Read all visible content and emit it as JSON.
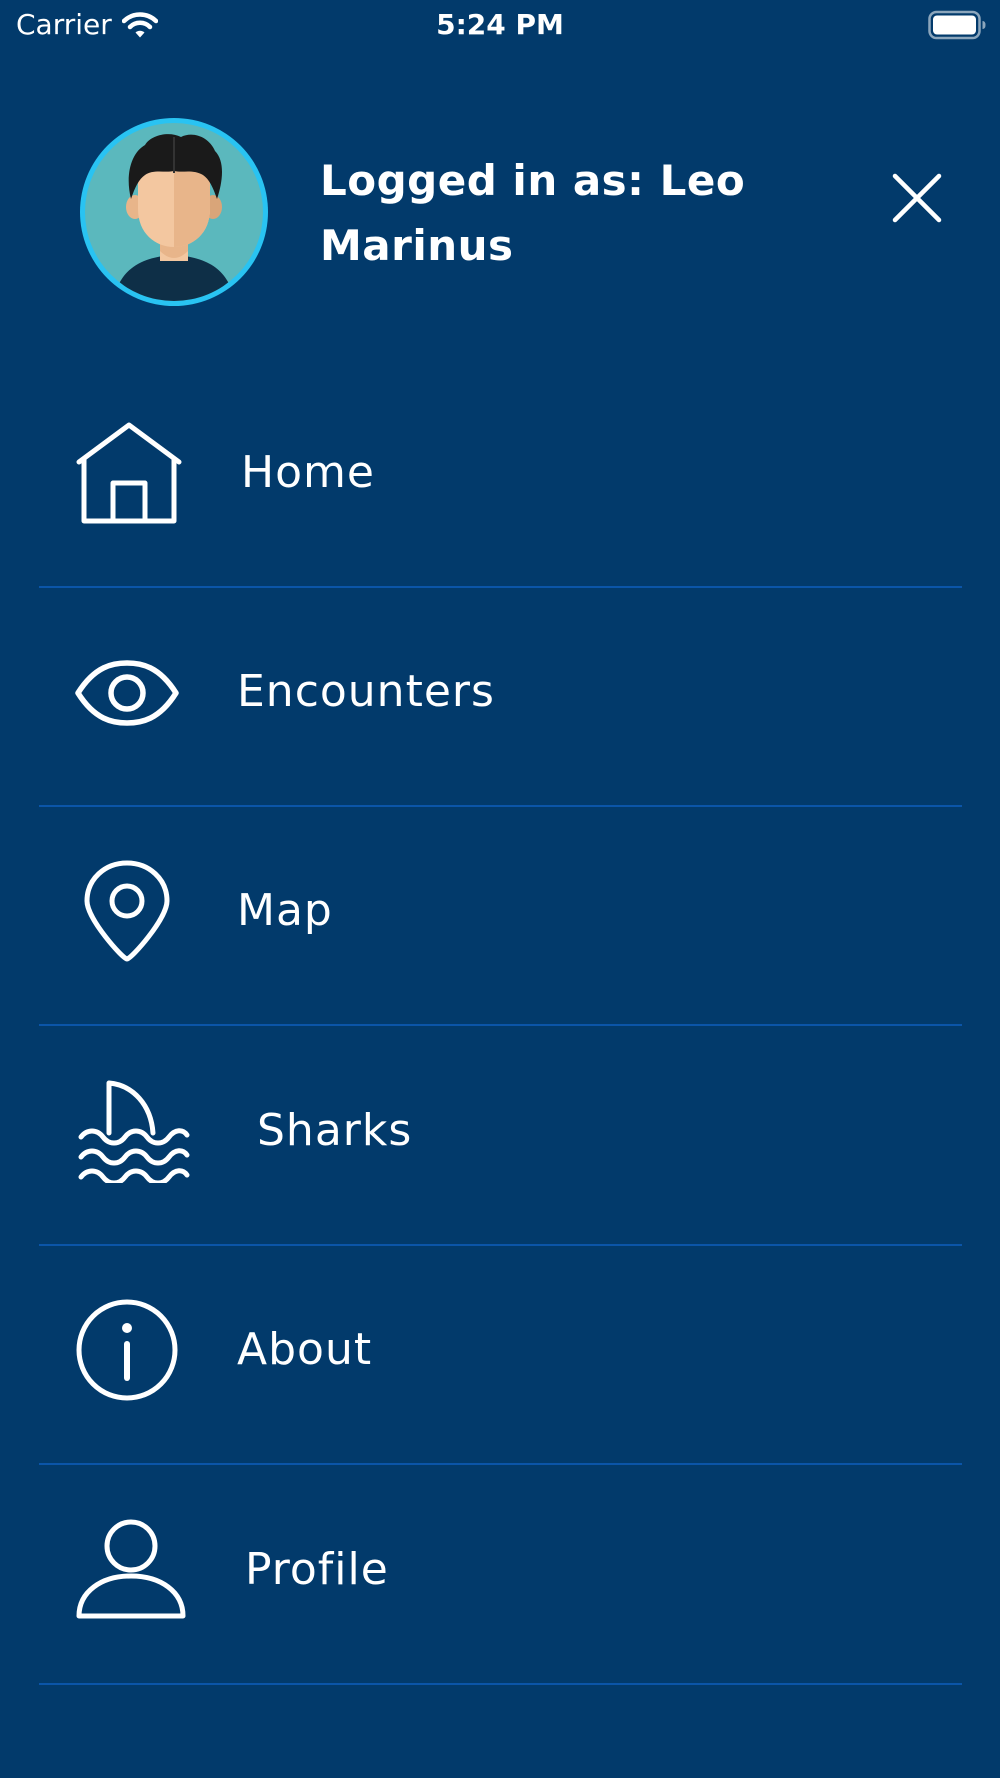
{
  "status_bar": {
    "carrier": "Carrier",
    "time": "5:24 PM",
    "icons": [
      "wifi-icon",
      "battery-icon"
    ]
  },
  "header": {
    "title": "Logged in as: Leo Marinus",
    "avatar": "user-avatar",
    "close_icon": "close-icon"
  },
  "menu": {
    "items": [
      {
        "label": "Home",
        "icon": "home-icon"
      },
      {
        "label": "Encounters",
        "icon": "eye-icon"
      },
      {
        "label": "Map",
        "icon": "map-pin-icon"
      },
      {
        "label": "Sharks",
        "icon": "shark-fin-icon"
      },
      {
        "label": "About",
        "icon": "info-icon"
      },
      {
        "label": "Profile",
        "icon": "person-icon"
      }
    ]
  },
  "colors": {
    "background": "#023A6B",
    "divider": "#0B55A8",
    "avatar_ring": "#29C3F2",
    "text": "#FFFFFF"
  }
}
